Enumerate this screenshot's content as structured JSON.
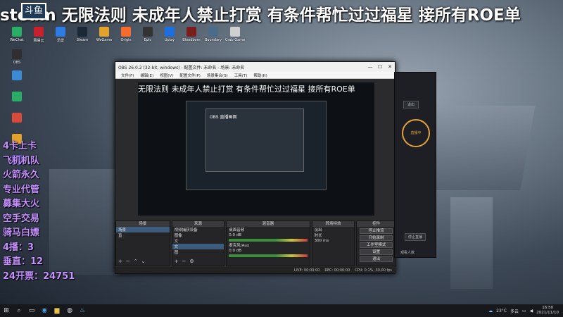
{
  "stream_marquee": "steam 无限法则 未成年人禁止打赏 有条件帮忙过过福星 接所有ROE单",
  "logo_text": "斗鱼",
  "desktop_icons": [
    {
      "label": "WeChat",
      "color": "#2aae67"
    },
    {
      "label": "网易云",
      "color": "#c8202d"
    },
    {
      "label": "迅雷",
      "color": "#2d7be4"
    },
    {
      "label": "Steam",
      "color": "#1b2838"
    },
    {
      "label": "WeGame",
      "color": "#e2a22c"
    },
    {
      "label": "Origin",
      "color": "#f56c2d"
    },
    {
      "label": "Epic",
      "color": "#333"
    },
    {
      "label": "Uplay",
      "color": "#1d6fe0"
    },
    {
      "label": "Bloodborn",
      "color": "#7b1d1d"
    },
    {
      "label": "Boundary",
      "color": "#4a6b8a"
    },
    {
      "label": "Crab Game",
      "color": "#d0d0d0"
    },
    {
      "label": "OBS",
      "color": "#302e31"
    }
  ],
  "left_overlay": [
    {
      "text": "4卡上卡"
    },
    {
      "text": "飞机机队"
    },
    {
      "text": "火箭永久"
    },
    {
      "text": "专业代管"
    },
    {
      "text": "募集大火"
    },
    {
      "text": "空手交易"
    },
    {
      "text": "骑马白嫖"
    },
    {
      "text": "4播：3"
    },
    {
      "text": "垂直：12"
    },
    {
      "text": "24开票：24751"
    }
  ],
  "obs": {
    "title": "OBS 26.0.2 (32-bit, windows) - 配置文件: 未命名 - 场景: 未命名",
    "menu": [
      "文件(F)",
      "编辑(E)",
      "视图(V)",
      "配置文件(P)",
      "场景集合(S)",
      "工具(T)",
      "帮助(H)"
    ],
    "window_controls": [
      "—",
      "☐",
      "✕"
    ],
    "preview_marquee": "无限法则 未成年人禁止打赏 有条件帮忙过过福星 接所有ROE单",
    "preview_sub": "OBS 直播画面",
    "scenes": {
      "header": "场景",
      "items": [
        "场景",
        "直"
      ]
    },
    "sources": {
      "header": "来源",
      "items": [
        "视频捕获设备",
        "图像",
        "文",
        "文",
        "图",
        "文"
      ]
    },
    "mixer": {
      "header": "混音器",
      "channels": [
        {
          "name": "桌面音频",
          "db": "0.0 dB"
        },
        {
          "name": "麦克风/Aux",
          "db": "0.0 dB"
        }
      ]
    },
    "transitions": {
      "header": "转场特效",
      "type": "淡出",
      "duration_label": "时长",
      "duration": "300 ms"
    },
    "controls": {
      "header": "控件",
      "buttons": [
        "停止推流",
        "开始录制",
        "工作室模式",
        "设置",
        "退出"
      ]
    },
    "status": {
      "live": "LIVE: 00:00:00",
      "rec": "REC: 00:00:00",
      "cpu": "CPU: 0.1%, 30.00 fps"
    }
  },
  "assistant": {
    "button": "退出",
    "ring_text": "直播中",
    "button2": "停止直播",
    "stat": "观看人数"
  },
  "taskbar": {
    "temperature": "23°C",
    "weather": "多云",
    "time": "16:50",
    "date": "2021/11/10"
  }
}
